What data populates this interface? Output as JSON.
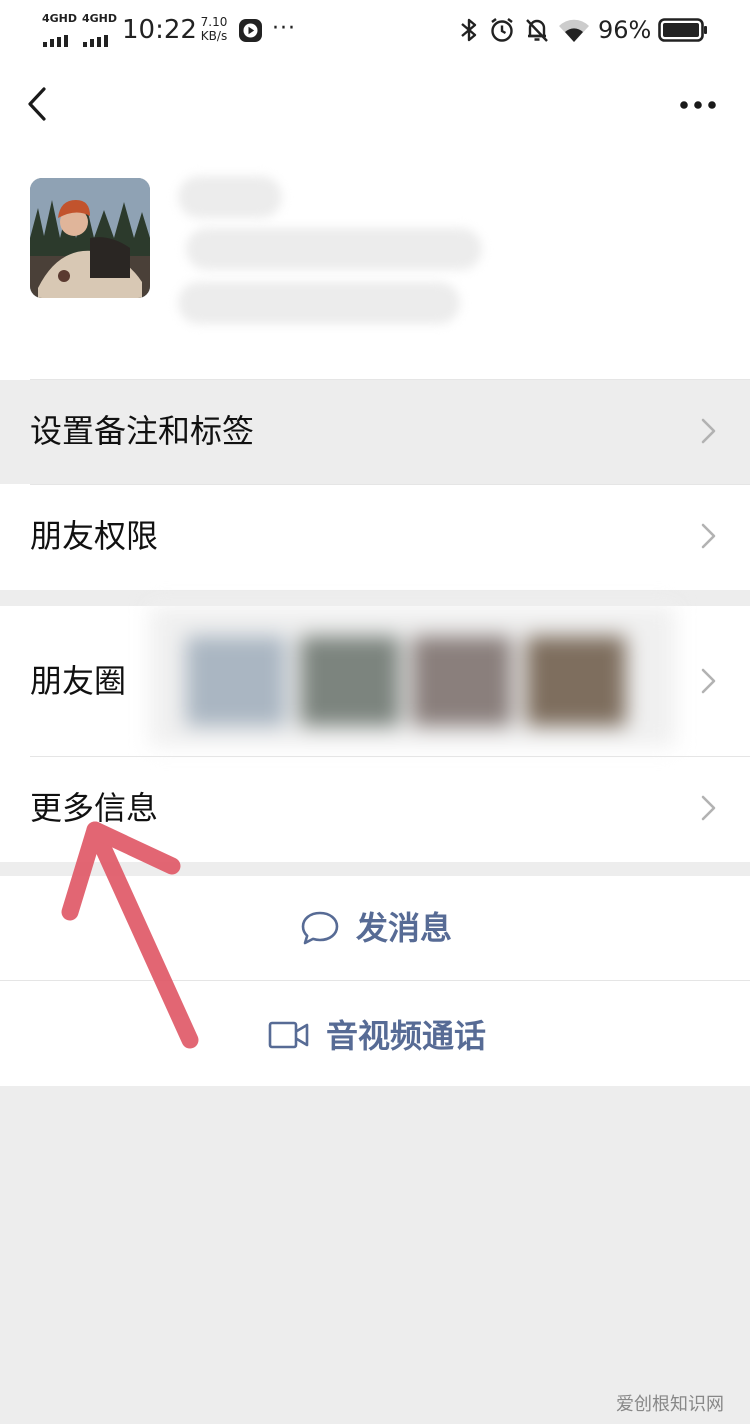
{
  "status_bar": {
    "signal1_label": "4GHD",
    "signal2_label": "4GHD",
    "time": "10:22",
    "net_speed_value": "7.10",
    "net_speed_unit": "KB/s",
    "overflow": "···",
    "battery_percent": "96%",
    "icons": [
      "bluetooth-icon",
      "alarm-icon",
      "bell-muted-icon",
      "wifi-icon",
      "battery-icon"
    ]
  },
  "header": {
    "back_icon": "chevron-left-icon",
    "more_icon": "more-dots-icon"
  },
  "menu": {
    "set_remark_tags": "设置备注和标签",
    "friend_permissions": "朋友权限",
    "moments": "朋友圈",
    "more_info": "更多信息"
  },
  "actions": {
    "send_message": "发消息",
    "video_call": "音视频通话"
  },
  "watermark": "爱创根知识网",
  "colors": {
    "link": "#576b95",
    "background": "#ededed",
    "annotation_arrow": "#e05a68"
  }
}
